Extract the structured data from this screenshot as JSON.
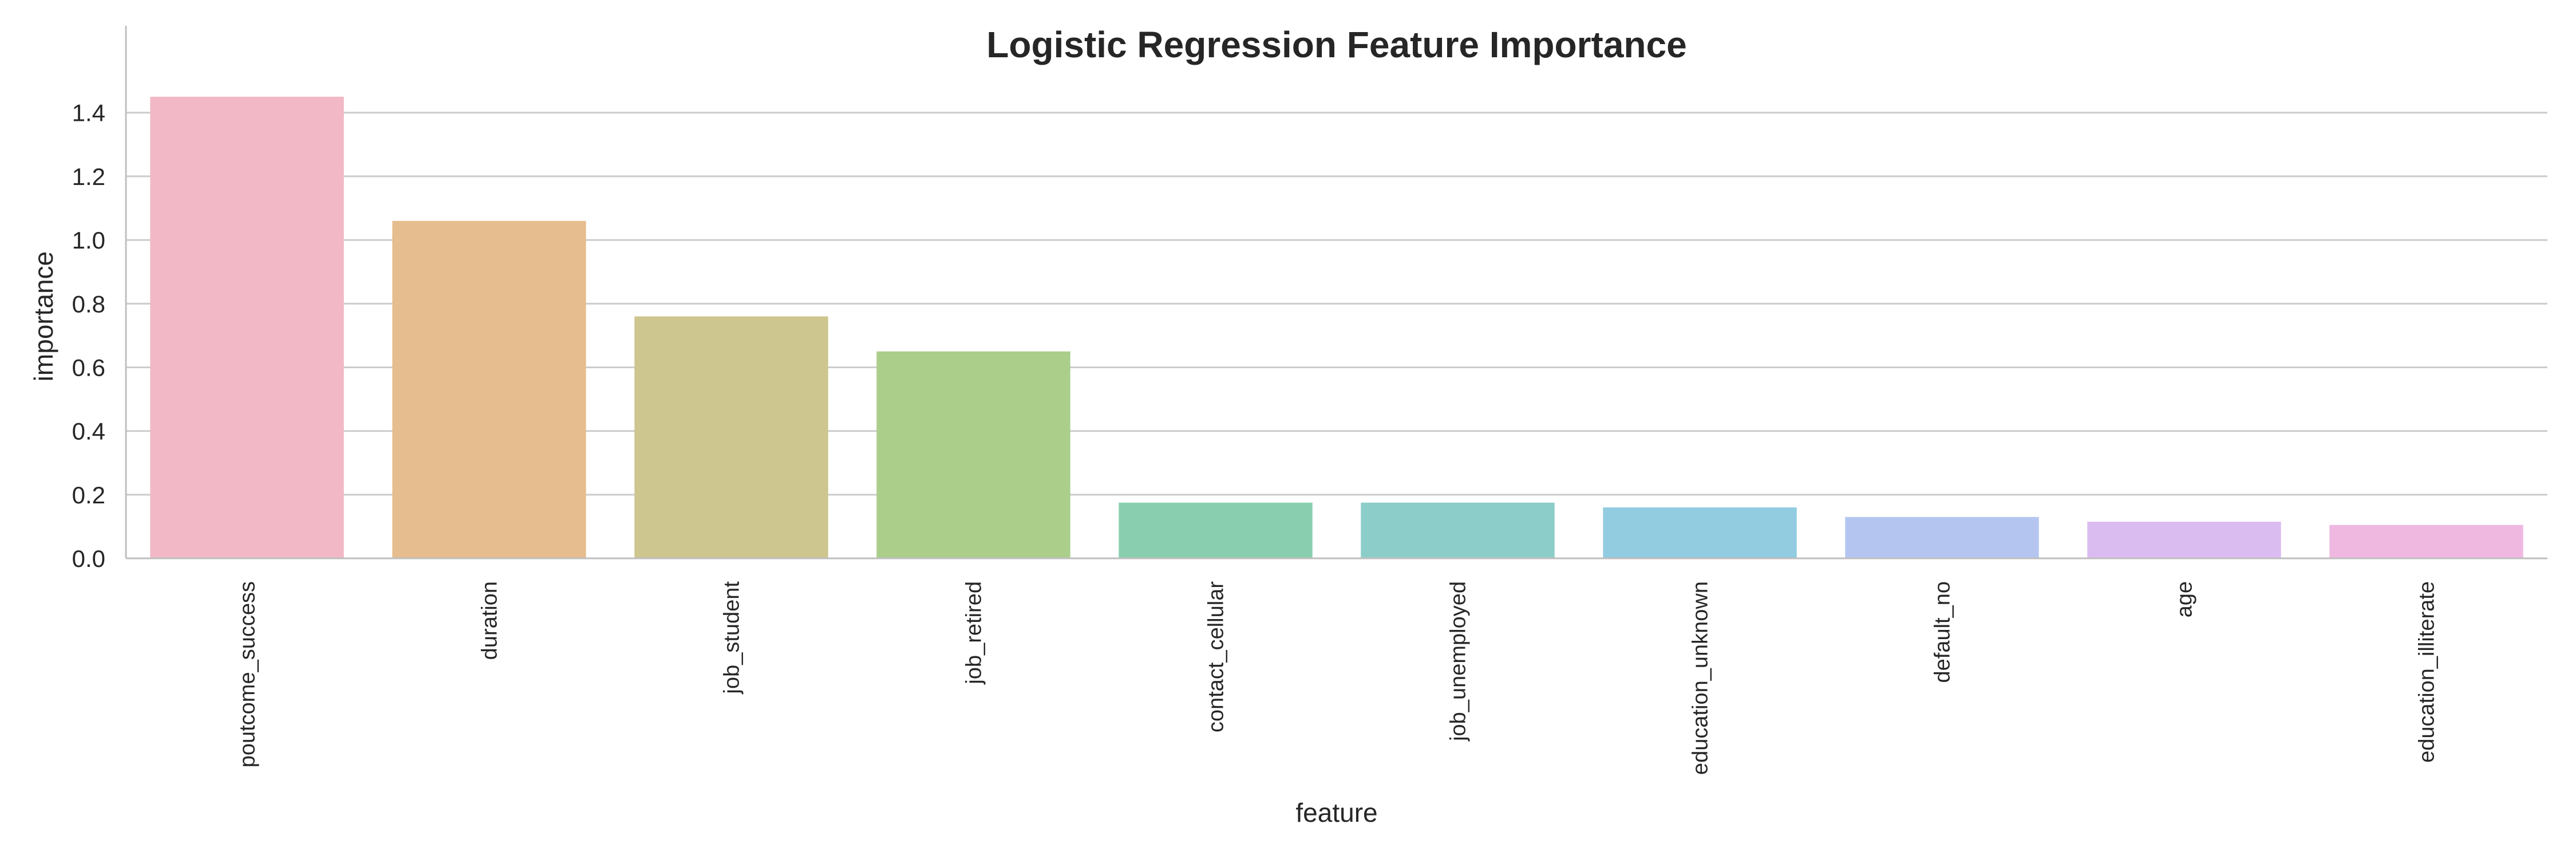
{
  "chart_data": {
    "type": "bar",
    "title": "Logistic Regression Feature Importance",
    "xlabel": "feature",
    "ylabel": "importance",
    "categories": [
      "poutcome_success",
      "duration",
      "job_student",
      "job_retired",
      "contact_cellular",
      "job_unemployed",
      "education_unknown",
      "default_no",
      "age",
      "education_illiterate"
    ],
    "values": [
      1.45,
      1.06,
      0.76,
      0.65,
      0.175,
      0.175,
      0.16,
      0.13,
      0.115,
      0.105
    ],
    "ylim": [
      0,
      1.52
    ],
    "yticks": [
      "0.0",
      "0.2",
      "0.4",
      "0.6",
      "0.8",
      "1.0",
      "1.2",
      "1.4"
    ],
    "grid": true,
    "colors": [
      "#f2b8c6",
      "#e6bd8e",
      "#cdc68e",
      "#abce8b",
      "#89cfaf",
      "#8ccdc9",
      "#91cce0",
      "#b4c6f0",
      "#dbbcf1",
      "#efb8e1"
    ]
  }
}
